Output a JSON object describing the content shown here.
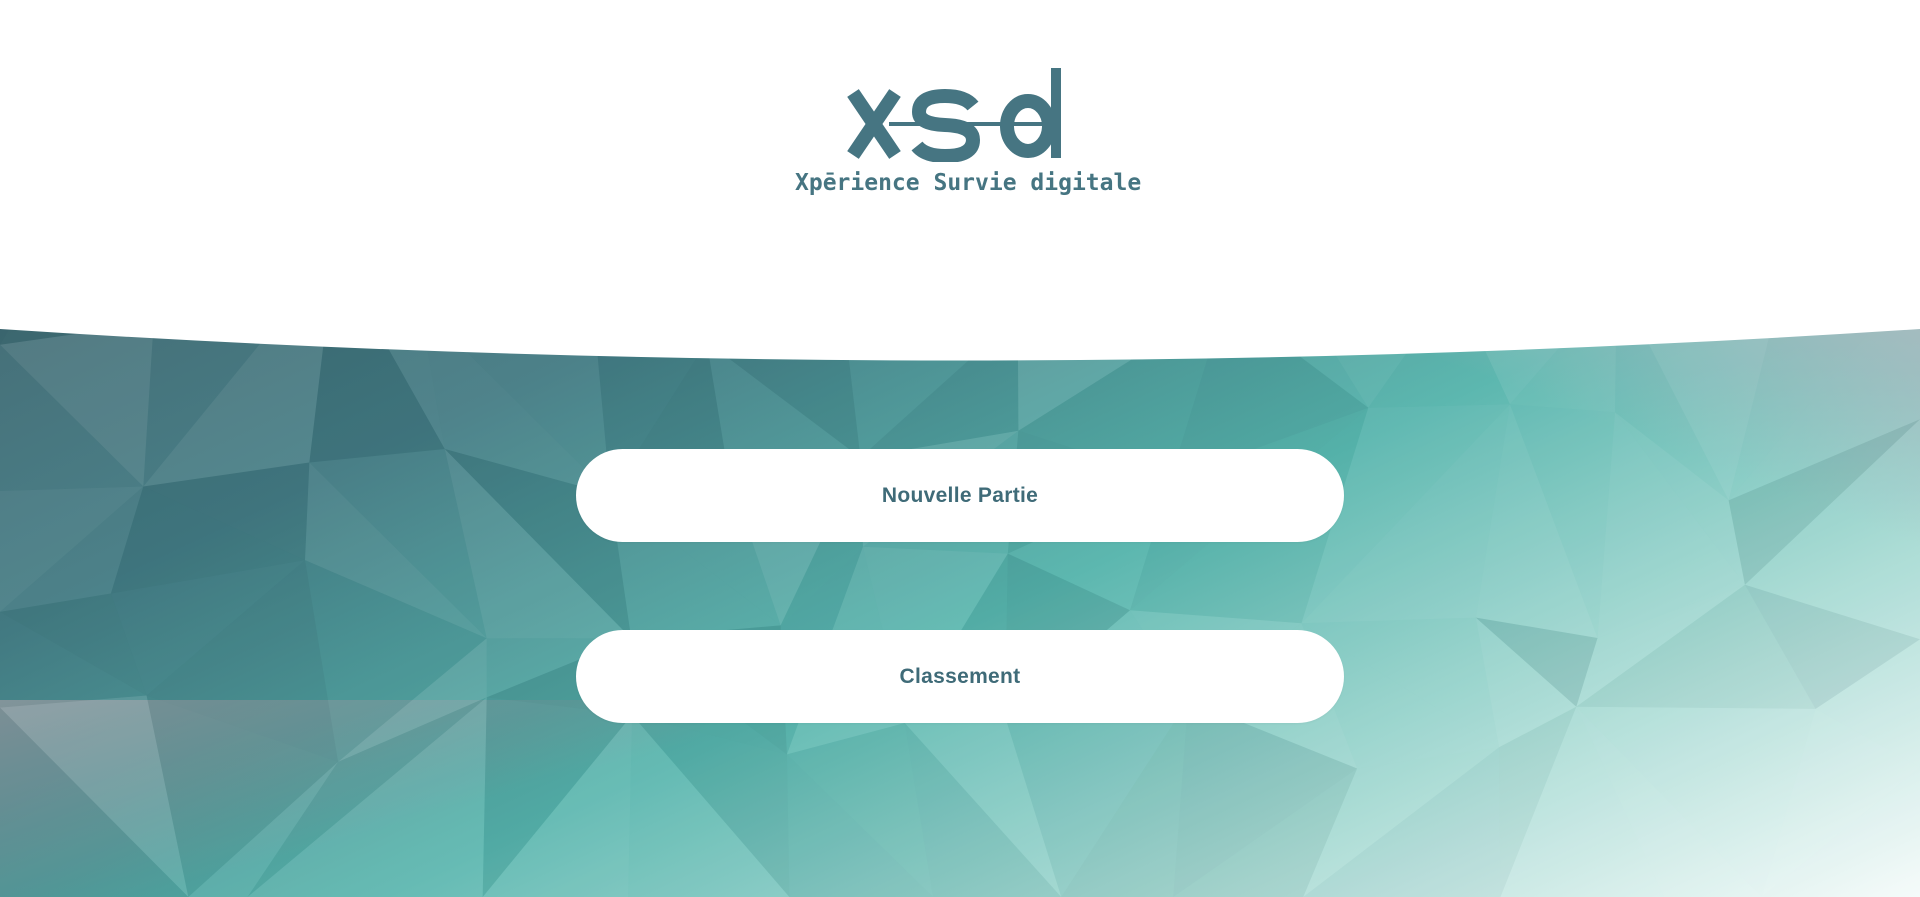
{
  "brand": {
    "logo_mark_text": "xsd",
    "tagline": "Xpērience Survie digitale",
    "color": "#467582"
  },
  "menu": {
    "new_game_label": "Nouvelle Partie",
    "leaderboard_label": "Classement"
  },
  "colors": {
    "button_text": "#3f6b78",
    "button_bg": "#ffffff",
    "background_dark": "#3a5c68",
    "background_mid": "#4fa6a4",
    "background_light": "#eaf6f4"
  }
}
